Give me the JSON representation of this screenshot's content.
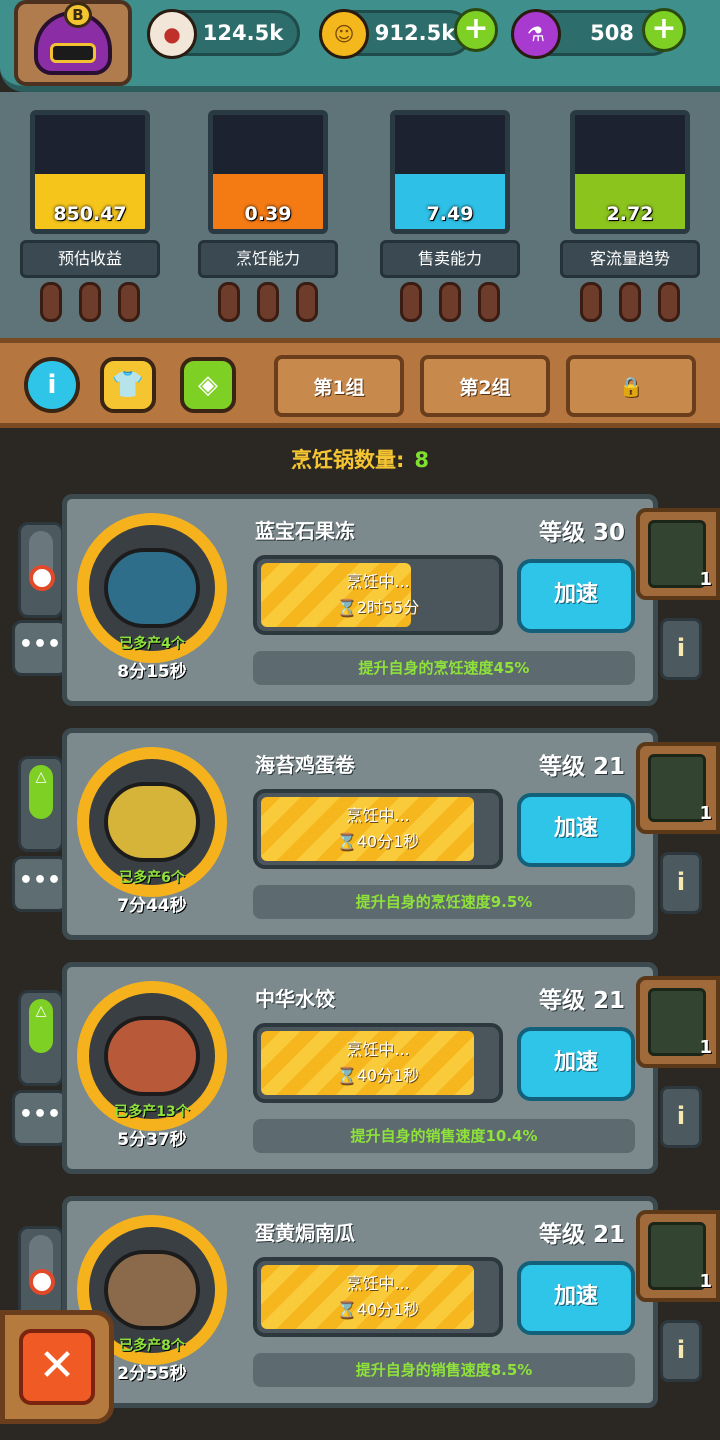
{
  "profile": {
    "rank_badge": "B"
  },
  "resources": [
    {
      "icon": "eyeball-icon",
      "value": "124.5k"
    },
    {
      "icon": "coin-icon",
      "value": "912.5k"
    },
    {
      "icon": "potion-icon",
      "value": "508"
    }
  ],
  "meters": [
    {
      "label": "预估收益",
      "value": "850.47",
      "color": "#f5c51c",
      "fill_fraction": 0.48
    },
    {
      "label": "烹饪能力",
      "value": "0.39",
      "color": "#f47a14",
      "fill_fraction": 0.48
    },
    {
      "label": "售卖能力",
      "value": "7.49",
      "color": "#2ec0e6",
      "fill_fraction": 0.48
    },
    {
      "label": "客流量趋势",
      "value": "2.72",
      "color": "#8cc41e",
      "fill_fraction": 0.48
    }
  ],
  "tabs": {
    "icons": [
      "info-icon",
      "shirt-icon",
      "food-box-icon"
    ],
    "groups": [
      "第1组",
      "第2组"
    ],
    "locked_icon": "lock-icon"
  },
  "pot_count": {
    "label": "烹饪锅数量:",
    "value": "8"
  },
  "cards": [
    {
      "name": "蓝宝石果冻",
      "level": "等级 30",
      "status": "烹饪中...",
      "remaining": "⌛2时55分",
      "progress": 0.62,
      "speed_label": "加速",
      "bonus": "提升自身的烹饪速度45%",
      "produced": "已多产4个",
      "cycle_time": "8分15秒",
      "toggle": "off",
      "chef_count": "1",
      "food_color": "#2e6e8a"
    },
    {
      "name": "海苔鸡蛋卷",
      "level": "等级 21",
      "status": "烹饪中...",
      "remaining": "⌛40分1秒",
      "progress": 0.88,
      "speed_label": "加速",
      "bonus": "提升自身的烹饪速度9.5%",
      "produced": "已多产6个",
      "cycle_time": "7分44秒",
      "toggle": "on",
      "chef_count": "1",
      "food_color": "#d6b43a"
    },
    {
      "name": "中华水饺",
      "level": "等级 21",
      "status": "烹饪中...",
      "remaining": "⌛40分1秒",
      "progress": 0.88,
      "speed_label": "加速",
      "bonus": "提升自身的销售速度10.4%",
      "produced": "已多产13个",
      "cycle_time": "5分37秒",
      "toggle": "on",
      "chef_count": "1",
      "food_color": "#b85a3a"
    },
    {
      "name": "蛋黄焗南瓜",
      "level": "等级 21",
      "status": "烹饪中...",
      "remaining": "⌛40分1秒",
      "progress": 0.88,
      "speed_label": "加速",
      "bonus": "提升自身的销售速度8.5%",
      "produced": "已多产8个",
      "cycle_time": "2分55秒",
      "toggle": "off",
      "chef_count": "1",
      "food_color": "#8a6a4a"
    }
  ],
  "close_label": "✕"
}
